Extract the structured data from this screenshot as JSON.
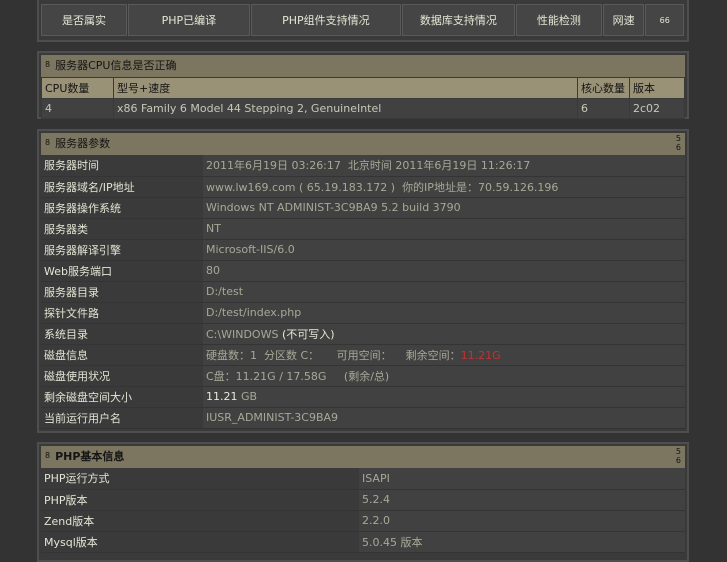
{
  "nav": {
    "items": [
      "是否属实",
      "PHP已编译",
      "PHP组件支持情况",
      "数据库支持情况",
      "性能检测",
      "网速",
      "66"
    ]
  },
  "cpu_panel": {
    "num": "8",
    "title": "服务器CPU信息是否正确",
    "headers": [
      "CPU数量",
      "型号+速度",
      "核心数量",
      "版本"
    ],
    "row": [
      "4",
      "x86 Family 6 Model 44 Stepping 2, GenuineIntel",
      "6",
      "2c02"
    ]
  },
  "server_panel": {
    "num": "8",
    "title": "服务器参数",
    "ctl_top": "5",
    "ctl_bottom": "6",
    "rows": [
      {
        "label": "服务器时间",
        "value": "2011年6月19日 03:26:17",
        "extra_label": "北京时间",
        "extra_value": "2011年6月19日 11:26:17"
      },
      {
        "label": "服务器域名/IP地址",
        "value": "www.lw169.com ( 65.19.183.172 )",
        "extra_label": "你的IP地址是：",
        "extra_value": "70.59.126.196"
      },
      {
        "label": "服务器操作系统",
        "value": "Windows NT ADMINIST-3C9BA9 5.2 build 3790"
      },
      {
        "label": "服务器类",
        "value": "NT"
      },
      {
        "label": "服务器解译引擎",
        "value": "Microsoft-IIS/6.0"
      },
      {
        "label": "Web服务端口",
        "value": "80"
      },
      {
        "label": "服务器目录",
        "value": "D:/test"
      },
      {
        "label": "探针文件路",
        "value": "D:/test/index.php"
      },
      {
        "label": "系统目录",
        "value": "C:\\WINDOWS",
        "paren": "不可写入"
      },
      {
        "label": "磁盘信息",
        "disk": [
          "硬盘数：1",
          "分区数 C：",
          "可用空间：",
          "剩余空间："
        ],
        "disk_red": "11.21G"
      },
      {
        "label": "磁盘使用状况",
        "value": "C盘：11.21G / 17.58G",
        "paren": "剩余/总"
      },
      {
        "label": "剩余磁盘空间大小",
        "free_num": "11.21",
        "free_unit": "GB"
      },
      {
        "label": "当前运行用户名",
        "value": "IUSR_ADMINIST-3C9BA9"
      }
    ]
  },
  "php_panel": {
    "num": "8",
    "title": "PHP基本信息",
    "ctl_top": "5",
    "ctl_bottom": "6",
    "rows": [
      {
        "label": "PHP运行方式",
        "value": "ISAPI"
      },
      {
        "label": "PHP版本",
        "value": "5.2.4"
      },
      {
        "label": "Zend版本",
        "value": "2.2.0"
      },
      {
        "label": "Mysql版本",
        "value": "5.0.45 版本"
      }
    ]
  }
}
